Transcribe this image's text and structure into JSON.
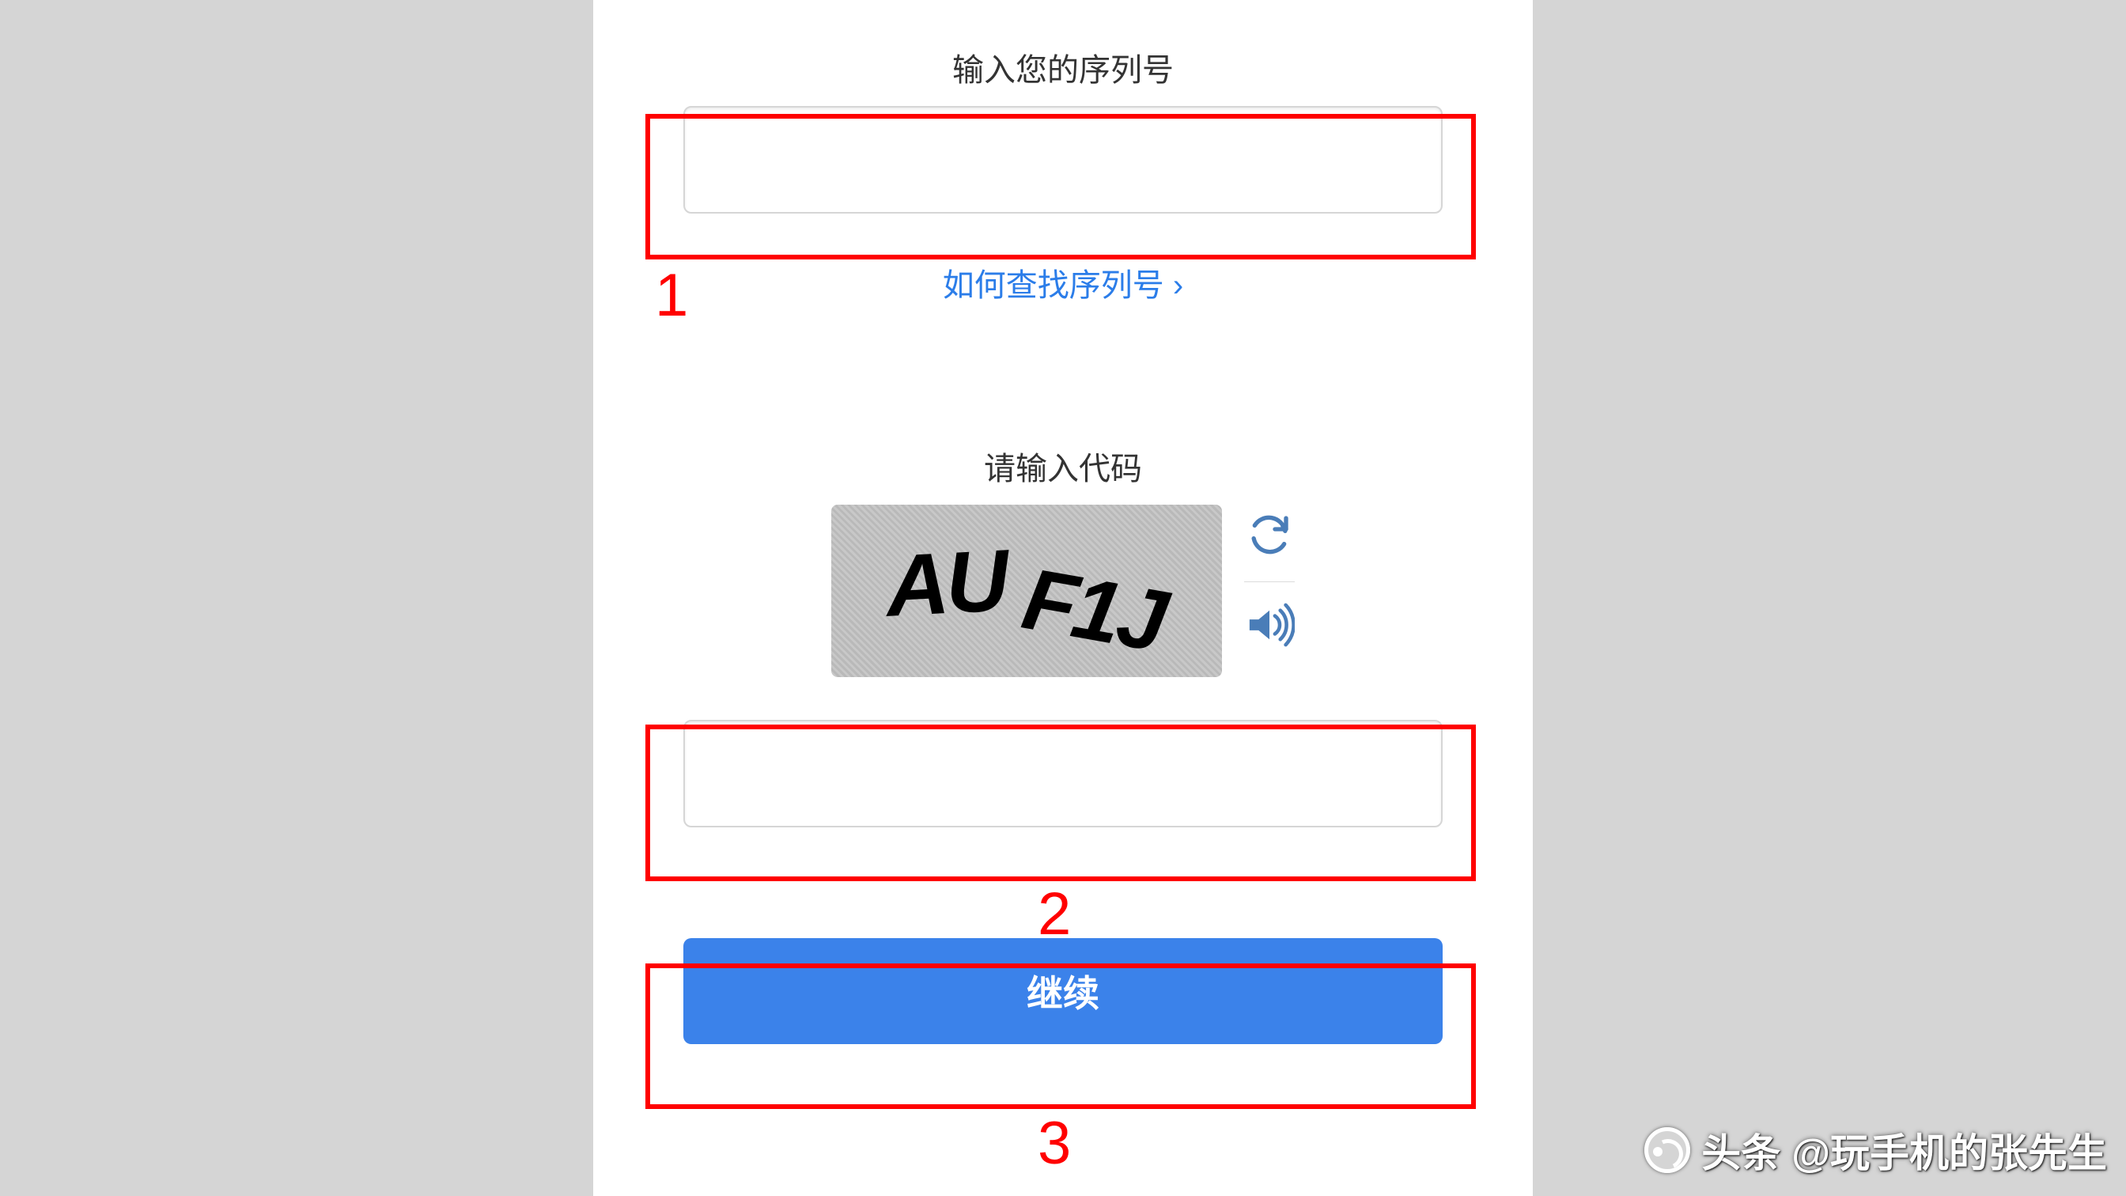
{
  "serial": {
    "label": "输入您的序列号",
    "help_link": "如何查找序列号 ›",
    "value": ""
  },
  "captcha": {
    "label": "请输入代码",
    "image_text": "AU F1J",
    "value": "",
    "refresh_icon": "refresh-icon",
    "audio_icon": "audio-icon"
  },
  "submit": {
    "label": "继续"
  },
  "annotations": {
    "one": "1",
    "two": "2",
    "three": "3"
  },
  "watermark": {
    "prefix": "头条",
    "handle": "@玩手机的张先生"
  }
}
